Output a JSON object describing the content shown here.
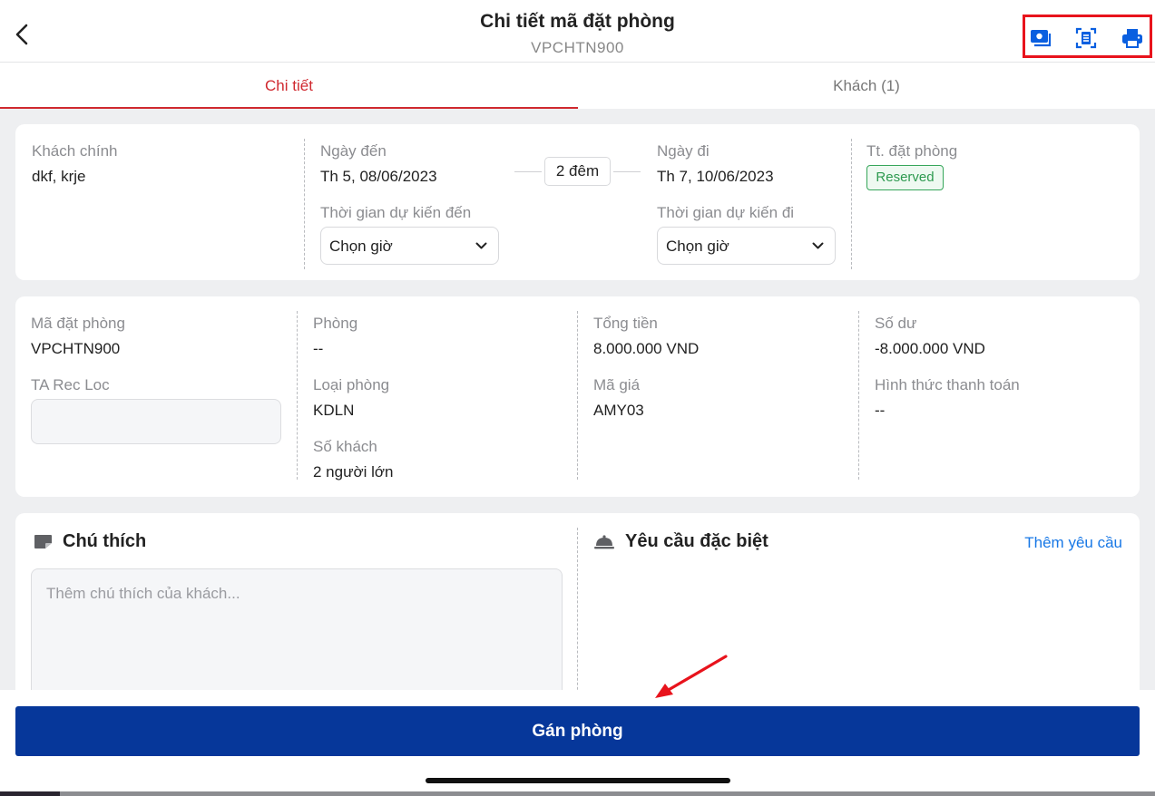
{
  "header": {
    "title": "Chi tiết mã đặt phòng",
    "subtitle": "VPCHTN900",
    "accent": "#0a5fe0",
    "highlight_color": "#e8131c"
  },
  "tabs": [
    {
      "label": "Chi tiết",
      "active": true
    },
    {
      "label": "Khách (1)",
      "active": false
    }
  ],
  "stay": {
    "guest_label": "Khách chính",
    "guest_value": "dkf, krje",
    "arrival_label": "Ngày đến",
    "arrival_value": "Th 5, 08/06/2023",
    "nights": "2 đêm",
    "departure_label": "Ngày đi",
    "departure_value": "Th 7, 10/06/2023",
    "status_label": "Tt. đặt phòng",
    "status_value": "Reserved",
    "eta_label": "Thời gian dự kiến đến",
    "eta_value": "Chọn giờ",
    "etd_label": "Thời gian dự kiến đi",
    "etd_value": "Chọn giờ"
  },
  "booking": {
    "code_label": "Mã đặt phòng",
    "code_value": "VPCHTN900",
    "ta_label": "TA Rec Loc",
    "room_label": "Phòng",
    "room_value": "--",
    "room_type_label": "Loại phòng",
    "room_type_value": "KDLN",
    "guests_label": "Số khách",
    "guests_value": "2 người lớn",
    "total_label": "Tổng tiền",
    "total_value": "8.000.000 VND",
    "rate_label": "Mã giá",
    "rate_value": "AMY03",
    "balance_label": "Số dư",
    "balance_value": "-8.000.000 VND",
    "payment_label": "Hình thức thanh toán",
    "payment_value": "--"
  },
  "notes": {
    "title": "Chú thích",
    "placeholder": "Thêm chú thích của khách...",
    "special_title": "Yêu cầu đặc biệt",
    "add_link": "Thêm yêu cầu"
  },
  "footer": {
    "button": "Gán phòng",
    "button_color": "#06379a"
  }
}
